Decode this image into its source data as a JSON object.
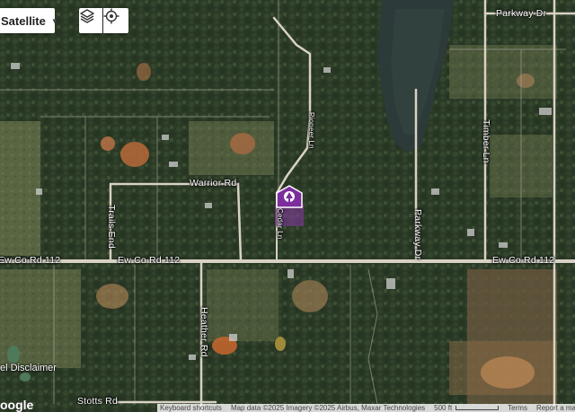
{
  "controls": {
    "map_type_label": "Satellite",
    "layers_icon": "layers-icon",
    "locate_icon": "crosshair-icon"
  },
  "roads": {
    "parkway_dr_top": "Parkway Dr",
    "warrior_rd": "Warrior Rd",
    "trails_end": "Trails End",
    "ew_co_rd_112_left": "Ew Co Rd 112",
    "ew_co_rd_112_mid": "Ew Co Rd 112",
    "ew_co_rd_112_right": "Ew Co Rd 112",
    "heather_rd": "Heather Rd",
    "stotts_rd": "Stotts Rd",
    "timber_ln": "Timber Ln",
    "parkway_dr_vertical": "Parkway Dr",
    "cedar_ln": "Cedar Ln",
    "pioneer_ln": "Pioneer Ln"
  },
  "marker": {
    "icon": "tree-house-icon",
    "color": "#7b2d9e"
  },
  "footer": {
    "disclaimer": "el Disclaimer",
    "google_logo": "oogle",
    "keyboard_shortcuts": "Keyboard shortcuts",
    "map_data": "Map data ©2025 Imagery ©2025 Airbus, Maxar Technologies",
    "scale": "500 ft",
    "terms": "Terms",
    "report": "Report a map"
  }
}
